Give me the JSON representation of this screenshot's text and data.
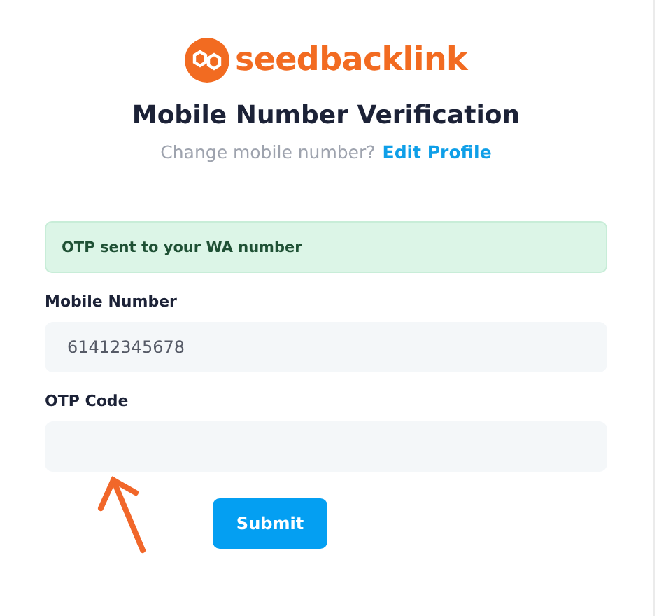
{
  "logo": {
    "text": "seedbacklink"
  },
  "title": "Mobile Number Verification",
  "subtitle": {
    "text": "Change mobile number?",
    "link": "Edit Profile"
  },
  "alert": {
    "text": "OTP sent to your WA number"
  },
  "fields": [
    {
      "label": "Mobile Number",
      "value": "61412345678"
    },
    {
      "label": "OTP Code"
    }
  ],
  "annotation": {
    "kind": "arrow"
  },
  "submit": "Submit"
}
